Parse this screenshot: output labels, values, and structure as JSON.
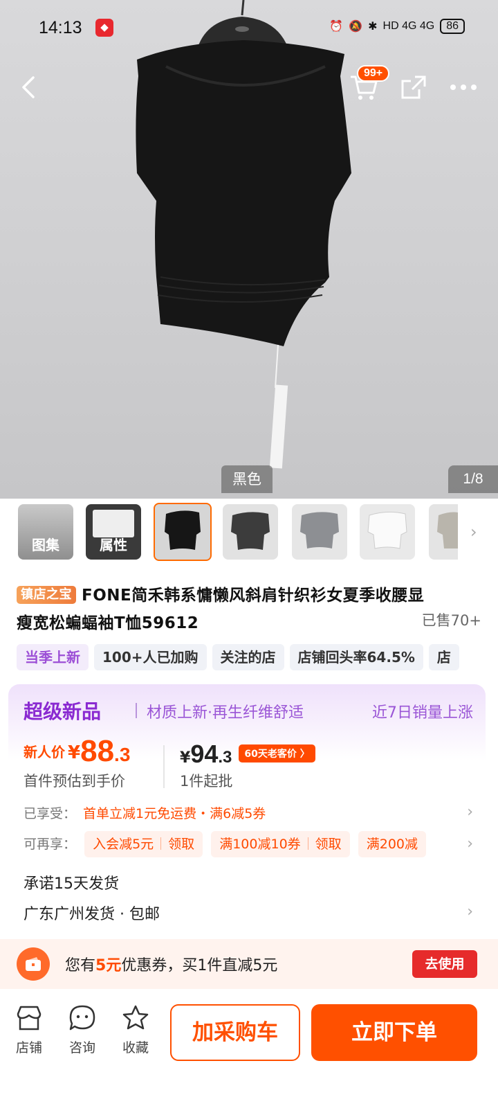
{
  "status_bar": {
    "time": "14:13",
    "network": "HD 4G 4G",
    "battery": "86"
  },
  "header": {
    "cart_badge": "99+"
  },
  "gallery": {
    "color_label": "黑色",
    "page_indicator": "1/8"
  },
  "thumbnails": [
    {
      "label": "图集"
    },
    {
      "label": "属性"
    }
  ],
  "product": {
    "shop_badge": "镇店之宝",
    "title_line1": "FONE简禾韩系慵懒风斜肩针织衫女夏季收腰显",
    "title_line2": "瘦宽松蝙蝠袖T恤59612",
    "sold": "已售70+"
  },
  "tags": [
    "当季上新",
    "100+人已加购",
    "关注的店",
    "店铺回头率64.5%",
    "店"
  ],
  "promo": {
    "title": "超级新品",
    "subtitle": "材质上新·再生纤维舒适",
    "right_text": "近7日销量上涨",
    "new_price_label": "新人价",
    "currency": "¥",
    "new_price_int": "88",
    "new_price_dec": ".3",
    "new_price_sub": "首件预估到手价",
    "old_price_int": "94",
    "old_price_dec": ".3",
    "old_price_badge": "60天老客价 〉",
    "old_price_sub": "1件起批",
    "enjoyed_label": "已享受：",
    "enjoyed_value": "首单立减1元免运费・满6减5券",
    "more_label": "可再享：",
    "coupons": [
      {
        "text": "入会减5元",
        "action": "领取"
      },
      {
        "text": "满100减10券",
        "action": "领取"
      },
      {
        "text": "满200减",
        "action": ""
      }
    ],
    "promise": "承诺15天发货",
    "shipping": "广东广州发货 · 包邮"
  },
  "coupon_bar": {
    "text_before": "您有",
    "amount": "5元",
    "text_after": "优惠券，买1件直减5元",
    "button": "去使用"
  },
  "bottom_bar": {
    "shop": "店铺",
    "consult": "咨询",
    "favorite": "收藏",
    "add_cart": "加采购车",
    "buy_now": "立即下单"
  },
  "colors": {
    "accent": "#ff5000",
    "purple": "#8a2ad1",
    "coupon_red": "#e62b2b"
  }
}
